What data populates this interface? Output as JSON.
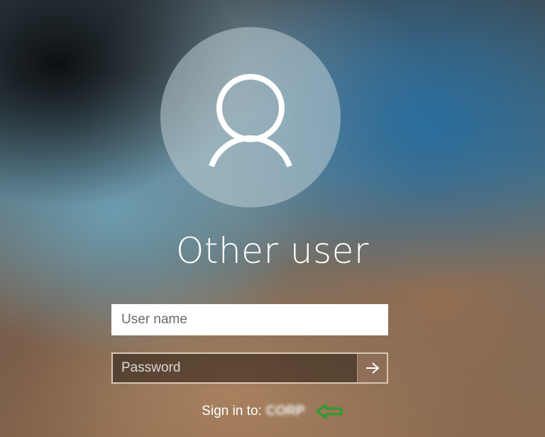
{
  "login": {
    "account_name": "Other user",
    "username_placeholder": "User name",
    "password_placeholder": "Password",
    "sign_in_label": "Sign in to:",
    "domain": "CORP"
  },
  "icons": {
    "avatar": "user-silhouette-icon",
    "submit": "arrow-right-icon",
    "annotation": "arrow-left-icon"
  },
  "colors": {
    "annotation_arrow": "#2e9b2e",
    "text": "#ffffff"
  }
}
